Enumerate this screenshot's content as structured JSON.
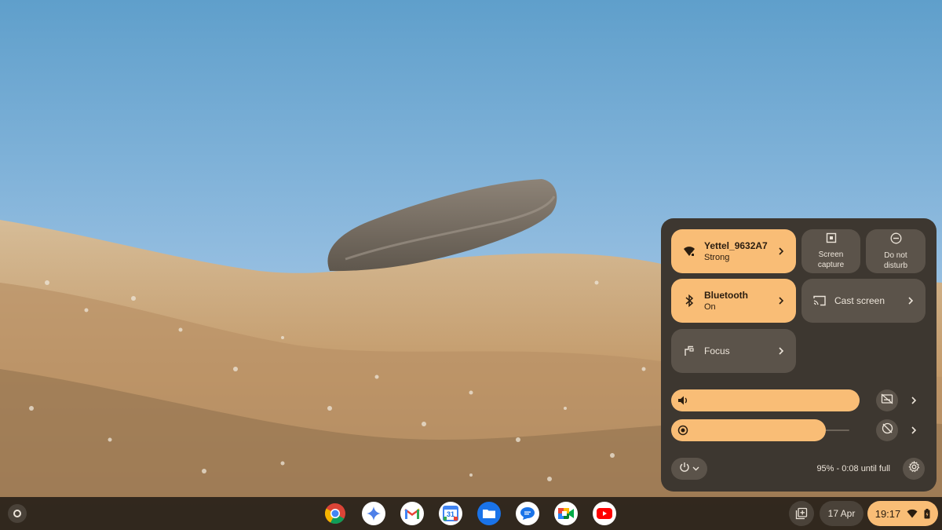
{
  "quick_settings": {
    "network": {
      "title": "Yettel_9632A7",
      "subtitle": "Strong",
      "icon": "wifi-lock-icon"
    },
    "bluetooth": {
      "title": "Bluetooth",
      "subtitle": "On",
      "icon": "bluetooth-icon"
    },
    "focus": {
      "title": "Focus",
      "icon": "focus-icon"
    },
    "screen_capture": {
      "line1": "Screen",
      "line2": "capture",
      "icon": "screen-capture-icon"
    },
    "do_not_disturb": {
      "line1": "Do not",
      "line2": "disturb",
      "icon": "do-not-disturb-icon"
    },
    "cast_screen": {
      "title": "Cast screen",
      "icon": "cast-icon"
    },
    "volume": {
      "level": 1.0,
      "icon": "volume-icon"
    },
    "brightness": {
      "level": 0.87,
      "icon": "brightness-icon"
    },
    "battery_status": "95% - 0:08 until full"
  },
  "shelf": {
    "apps": [
      "chrome-icon",
      "gemini-icon",
      "gmail-icon",
      "calendar-icon",
      "files-icon",
      "messages-icon",
      "meet-icon",
      "youtube-icon"
    ],
    "calendar_day": "31",
    "date": "17 Apr",
    "time": "19:17"
  },
  "colors": {
    "accent": "#f9bd76",
    "panel": "#3d3730",
    "tile_off": "#5b534a"
  }
}
